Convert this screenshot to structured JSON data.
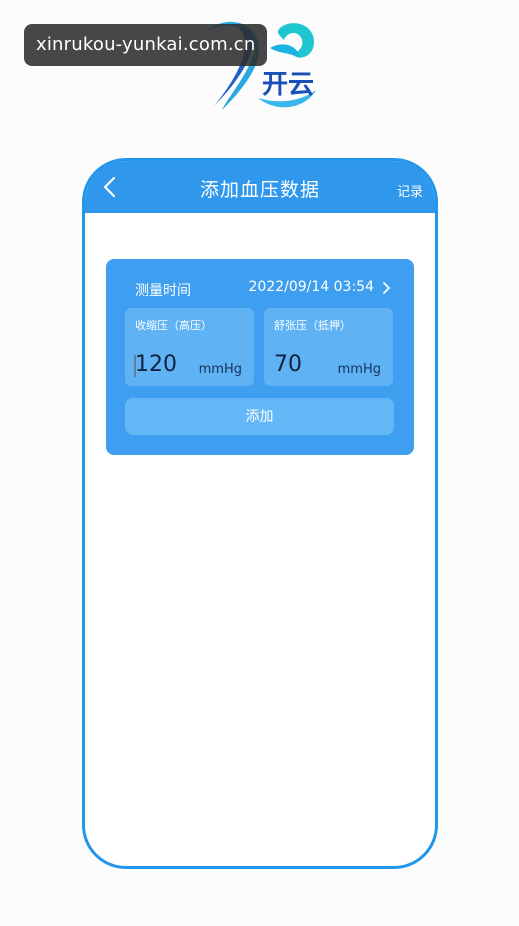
{
  "watermark": {
    "text": "xinrukou-yunkai.com.cn"
  },
  "logo": {
    "text": "开云",
    "icon": "brand-logo-icon"
  },
  "nav": {
    "back_icon": "chevron-left-icon",
    "title": "添加血压数据",
    "action": "记录"
  },
  "measure": {
    "time_label": "测量时间",
    "time_value": "2022/09/14 03:54",
    "chevron_icon": "chevron-right-icon"
  },
  "systolic": {
    "label": "收缩压（高压）",
    "value": "120",
    "unit": "mmHg"
  },
  "diastolic": {
    "label": "舒张压（抵押）",
    "value": "70",
    "unit": "mmHg"
  },
  "add_button": {
    "label": "添加"
  },
  "colors": {
    "primary": "#2f97ec",
    "card": "#3e9ff0",
    "field": "#5fb3f5",
    "button": "#64b7f6",
    "border": "#2196ea"
  }
}
